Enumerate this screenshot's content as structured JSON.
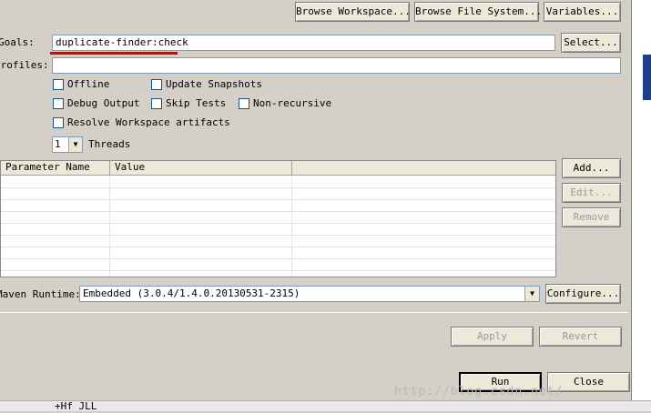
{
  "top_buttons": {
    "browse_workspace": "Browse Workspace...",
    "browse_file_system": "Browse File System...",
    "variables": "Variables..."
  },
  "goals": {
    "label": "Goals:",
    "value": "duplicate-finder:check",
    "select_button": "Select..."
  },
  "profiles": {
    "label": "Profiles:",
    "value": ""
  },
  "options": {
    "offline": "Offline",
    "update_snapshots": "Update Snapshots",
    "debug_output": "Debug Output",
    "skip_tests": "Skip Tests",
    "non_recursive": "Non-recursive",
    "resolve_workspace": "Resolve Workspace artifacts"
  },
  "threads": {
    "value": "1",
    "label": "Threads"
  },
  "params_table": {
    "columns": [
      "Parameter Name",
      "Value"
    ],
    "rows": 9
  },
  "table_buttons": {
    "add": "Add...",
    "edit": "Edit...",
    "remove": "Remove"
  },
  "runtime": {
    "label": "Maven Runtime:",
    "value": "Embedded (3.0.4/1.4.0.20130531-2315)",
    "configure_button": "Configure..."
  },
  "footer": {
    "apply": "Apply",
    "revert": "Revert",
    "run": "Run",
    "close": "Close",
    "watermark": "http://blog.csdn.net/",
    "bottom_text": "+Hf JLL"
  },
  "colors": {
    "annotation_underline": "#e00000",
    "window_background": "#d4d0c8"
  }
}
